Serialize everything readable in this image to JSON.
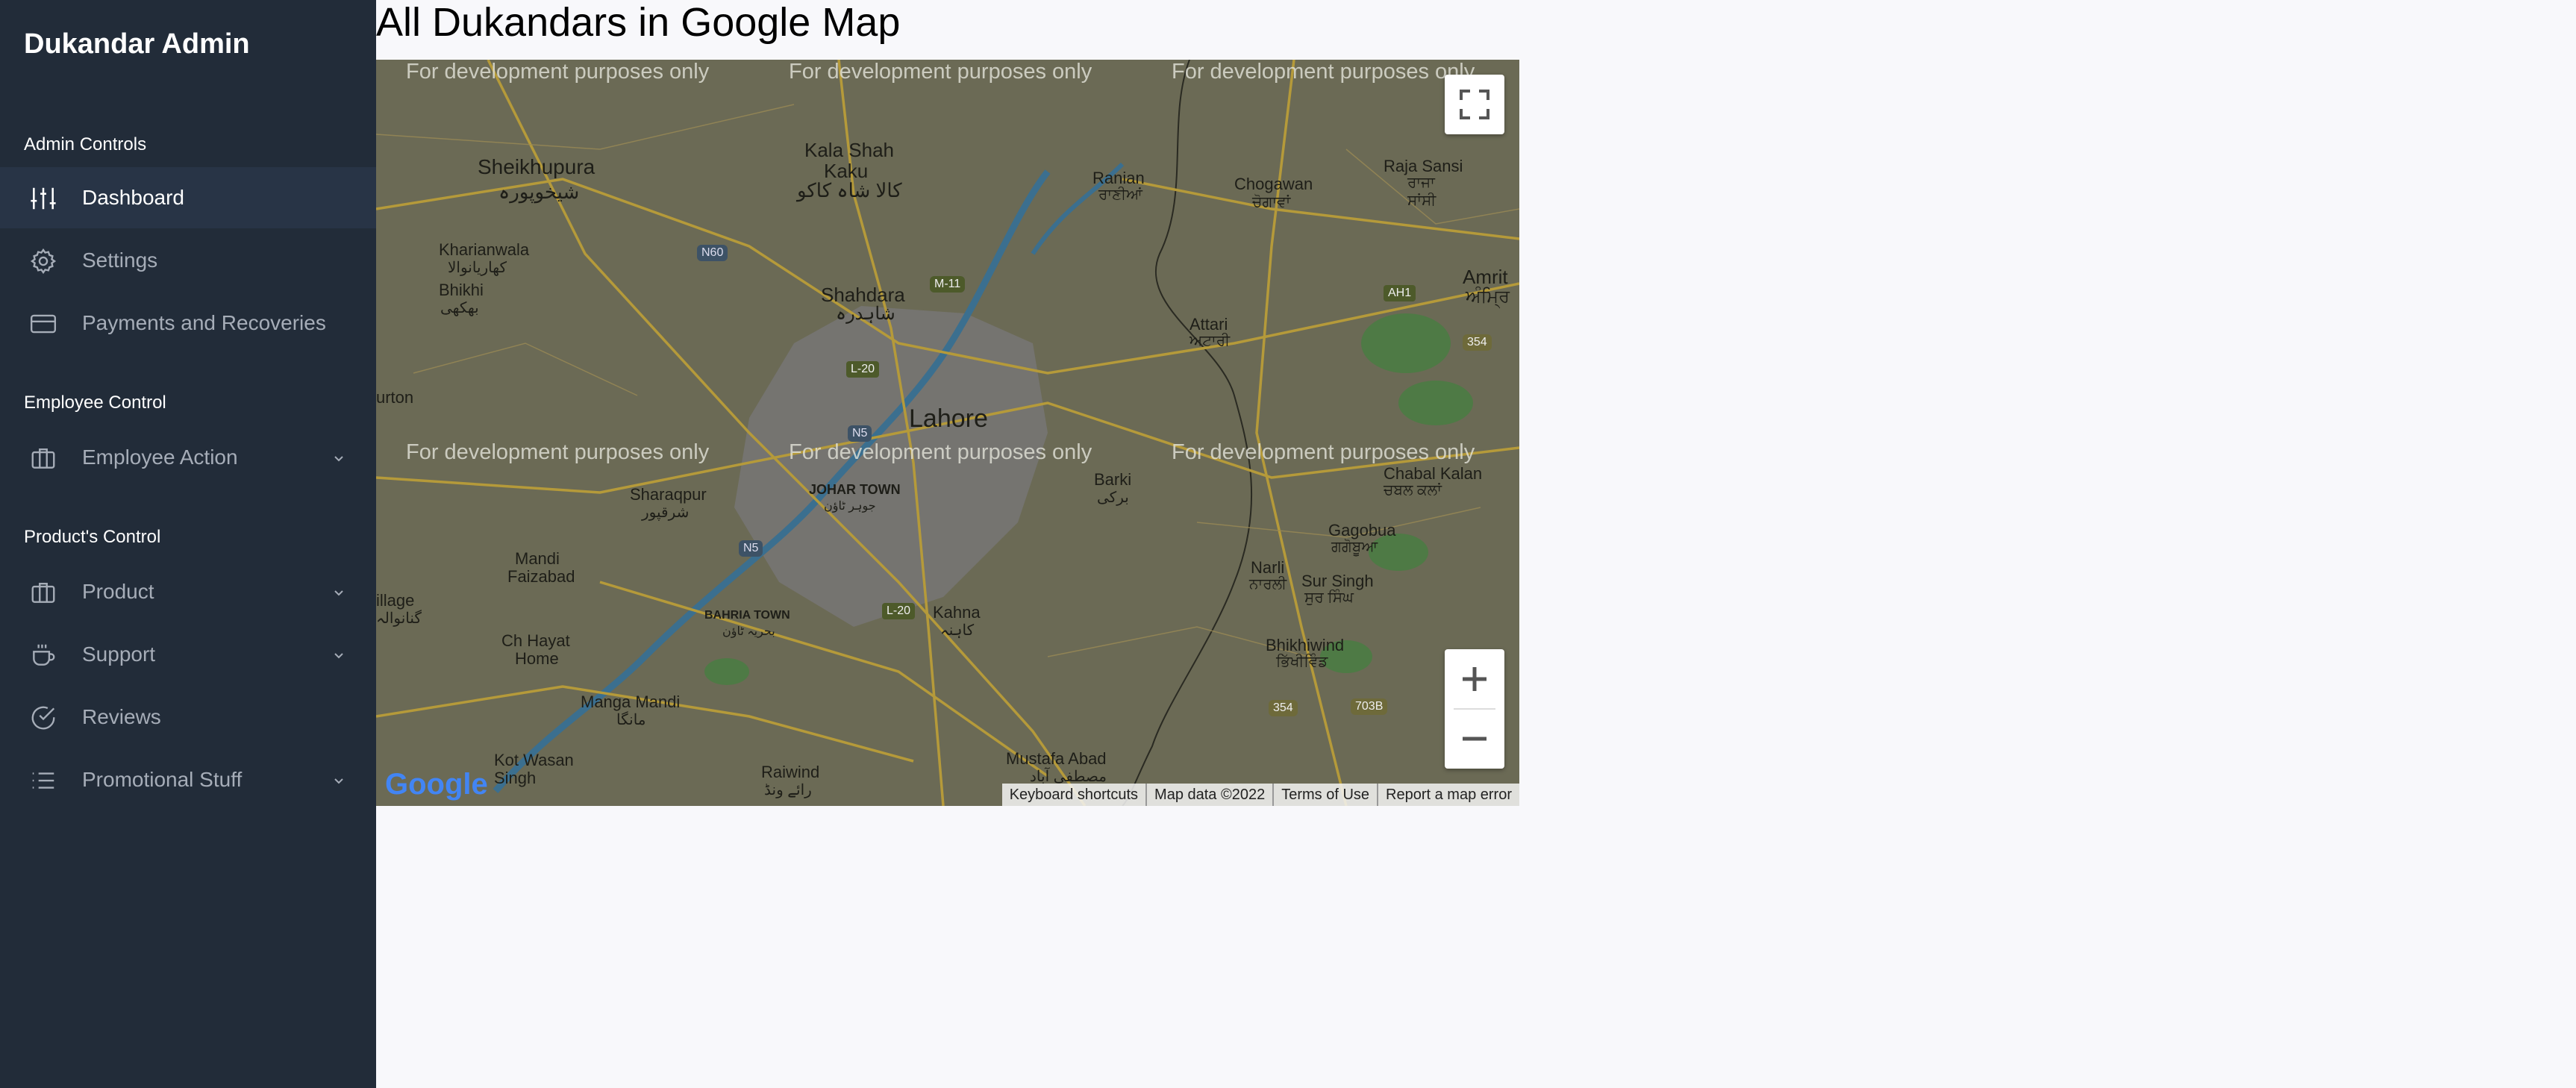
{
  "brand": "Dukandar Admin",
  "sections": {
    "admin": "Admin Controls",
    "employee": "Employee Control",
    "product": "Product's Control"
  },
  "nav": {
    "dashboard": "Dashboard",
    "settings": "Settings",
    "payments": "Payments and Recoveries",
    "employee_action": "Employee Action",
    "product": "Product",
    "support": "Support",
    "reviews": "Reviews",
    "promotional": "Promotional Stuff"
  },
  "page": {
    "title": "All Dukandars in Google Map"
  },
  "map": {
    "watermark": "For development purposes only",
    "places": {
      "sheikhupura": "Sheikhupura",
      "sheikhupura_ur": "شیخوپورہ",
      "kala_shah_kaku": "Kala Shah",
      "kala_shah_kaku2": "Kaku",
      "kala_shah_kaku_ur": "کالا شاہ کاکو",
      "ranian": "Ranian",
      "ranian_pa": "ਰਾਣੀਆਂ",
      "chogawan": "Chogawan",
      "chogawan_pa": "ਚੋਗਾਵਾਂ",
      "raja_sansi": "Raja Sansi",
      "raja_sansi_pa": "ਰਾਜਾ",
      "raja_sansi_pa2": "ਸਾਂਸੀ",
      "kharianwala": "Kharianwala",
      "kharianwala_ur": "کھاریانوالا",
      "bhikhi": "Bhikhi",
      "bhikhi_ur": "بھکھی",
      "shahdara": "Shahdara",
      "shahdara_ur": "شاہدرہ",
      "attari": "Attari",
      "attari_pa": "ਅਟਾਰੀ",
      "amritsar": "Amrit",
      "amritsar_pa": "ਅੰਮ੍ਰਿ",
      "lahore": "Lahore",
      "burton": "urton",
      "sharaqpur": "Sharaqpur",
      "sharaqpur_ur": "شرقپور",
      "johar_town": "JOHAR TOWN",
      "johar_town_ur": "جوہر ٹاؤن",
      "barki": "Barki",
      "barki_ur": "برکی",
      "chabal_kalan": "Chabal Kalan",
      "chabal_kalan_pa": "ਚਬਲ ਕਲਾਂ",
      "gagobua": "Gagobua",
      "gagobua_pa": "ਗਗੋਬੂਆ",
      "mandi_faizabad": "Mandi",
      "mandi_faizabad2": "Faizabad",
      "narli": "Narli",
      "narli_pa": "ਨਾਰਲੀ",
      "sur_singh": "Sur Singh",
      "sur_singh_pa": "ਸੁਰ ਸਿੰਘ",
      "village": "illage",
      "village_ur": "گنانوالہ",
      "bahria_town": "BAHRIA TOWN",
      "bahria_town_ur": "بحریہ ٹاؤن",
      "kahna": "Kahna",
      "kahna_ur": "کاہنہ",
      "ch_hayat": "Ch Hayat",
      "ch_hayat2": "Home",
      "bhikhiwind": "Bhikhiwind",
      "bhikhiwind_pa": "ਭਿੱਖੀਵਿੰਡ",
      "manga_mandi": "Manga Mandi",
      "manga_mandi_ur": "مانگا",
      "kot_wasan": "Kot Wasan",
      "kot_wasan2": "Singh",
      "raiwind": "Raiwind",
      "raiwind_ur": "رائے ونڈ",
      "mustafa_abad": "Mustafa Abad",
      "mustafa_abad_ur": "مصطفی آباد"
    },
    "shields": {
      "n60": "N60",
      "m11": "M-11",
      "ah1": "AH1",
      "r354a": "354",
      "l20a": "L-20",
      "n5a": "N5",
      "n5b": "N5",
      "l20b": "L-20",
      "r354b": "354",
      "r703b": "703B"
    },
    "attribution": {
      "shortcuts": "Keyboard shortcuts",
      "data": "Map data ©2022",
      "terms": "Terms of Use",
      "report": "Report a map error"
    },
    "logo": "Google"
  },
  "colors": {
    "sidebar_bg": "#222c39",
    "active_bg": "#283446",
    "map_overlay": "#6b6a55"
  }
}
